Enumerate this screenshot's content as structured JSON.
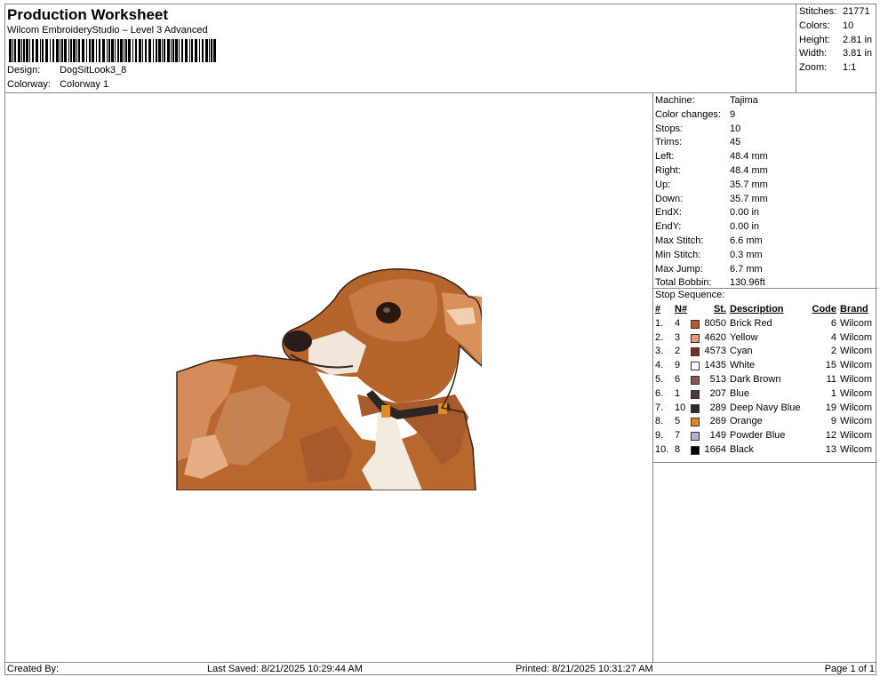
{
  "header": {
    "title": "Production Worksheet",
    "software": "Wilcom EmbroideryStudio – Level 3 Advanced",
    "design_label": "Design:",
    "design_value": "DogSitLook3_8",
    "colorway_label": "Colorway:",
    "colorway_value": "Colorway 1"
  },
  "summary": [
    {
      "label": "Stitches:",
      "value": "21771"
    },
    {
      "label": "Colors:",
      "value": "10"
    },
    {
      "label": "Height:",
      "value": "2.81 in"
    },
    {
      "label": "Width:",
      "value": "3.81 in"
    },
    {
      "label": "Zoom:",
      "value": "1:1"
    }
  ],
  "properties": [
    {
      "label": "Machine:",
      "value": "Tajima"
    },
    {
      "label": "Color changes:",
      "value": "9"
    },
    {
      "label": "Stops:",
      "value": "10"
    },
    {
      "label": "Trims:",
      "value": "45"
    },
    {
      "label": "Left:",
      "value": "48.4 mm"
    },
    {
      "label": "Right:",
      "value": "48.4 mm"
    },
    {
      "label": "Up:",
      "value": "35.7 mm"
    },
    {
      "label": "Down:",
      "value": "35.7 mm"
    },
    {
      "label": "EndX:",
      "value": "0.00 in"
    },
    {
      "label": "EndY:",
      "value": "0.00 in"
    },
    {
      "label": "Max Stitch:",
      "value": "6.6 mm"
    },
    {
      "label": "Min Stitch:",
      "value": "0.3 mm"
    },
    {
      "label": "Max Jump:",
      "value": "6.7 mm"
    },
    {
      "label": "Total Bobbin:",
      "value": "130.96ft"
    }
  ],
  "stop_sequence": {
    "title": "Stop Sequence:",
    "headers": {
      "idx": "#",
      "num": "N#",
      "st": "St.",
      "desc": "Description",
      "code": "Code",
      "brand": "Brand"
    },
    "rows": [
      {
        "idx": "1.",
        "num": "4",
        "color": "#b5582e",
        "st": "8050",
        "desc": "Brick Red",
        "code": "6",
        "brand": "Wilcom"
      },
      {
        "idx": "2.",
        "num": "3",
        "color": "#e59a7a",
        "st": "4620",
        "desc": "Yellow",
        "code": "4",
        "brand": "Wilcom"
      },
      {
        "idx": "3.",
        "num": "2",
        "color": "#7a2e22",
        "st": "4573",
        "desc": "Cyan",
        "code": "2",
        "brand": "Wilcom"
      },
      {
        "idx": "4.",
        "num": "9",
        "color": "#ffffff",
        "st": "1435",
        "desc": "White",
        "code": "15",
        "brand": "Wilcom"
      },
      {
        "idx": "5.",
        "num": "6",
        "color": "#8a5650",
        "st": "513",
        "desc": "Dark Brown",
        "code": "11",
        "brand": "Wilcom"
      },
      {
        "idx": "6.",
        "num": "1",
        "color": "#4a3a36",
        "st": "207",
        "desc": "Blue",
        "code": "1",
        "brand": "Wilcom"
      },
      {
        "idx": "7.",
        "num": "10",
        "color": "#2a2a2a",
        "st": "289",
        "desc": "Deep Navy Blue",
        "code": "19",
        "brand": "Wilcom"
      },
      {
        "idx": "8.",
        "num": "5",
        "color": "#e0861c",
        "st": "269",
        "desc": "Orange",
        "code": "9",
        "brand": "Wilcom"
      },
      {
        "idx": "9.",
        "num": "7",
        "color": "#b3b0cc",
        "st": "149",
        "desc": "Powder Blue",
        "code": "12",
        "brand": "Wilcom"
      },
      {
        "idx": "10.",
        "num": "8",
        "color": "#000000",
        "st": "1664",
        "desc": "Black",
        "code": "13",
        "brand": "Wilcom"
      }
    ]
  },
  "footer": {
    "created_by": "Created By:",
    "last_saved": "Last Saved: 8/21/2025 10:29:44 AM",
    "printed": "Printed: 8/21/2025 10:31:27 AM",
    "page": "Page 1 of 1"
  }
}
